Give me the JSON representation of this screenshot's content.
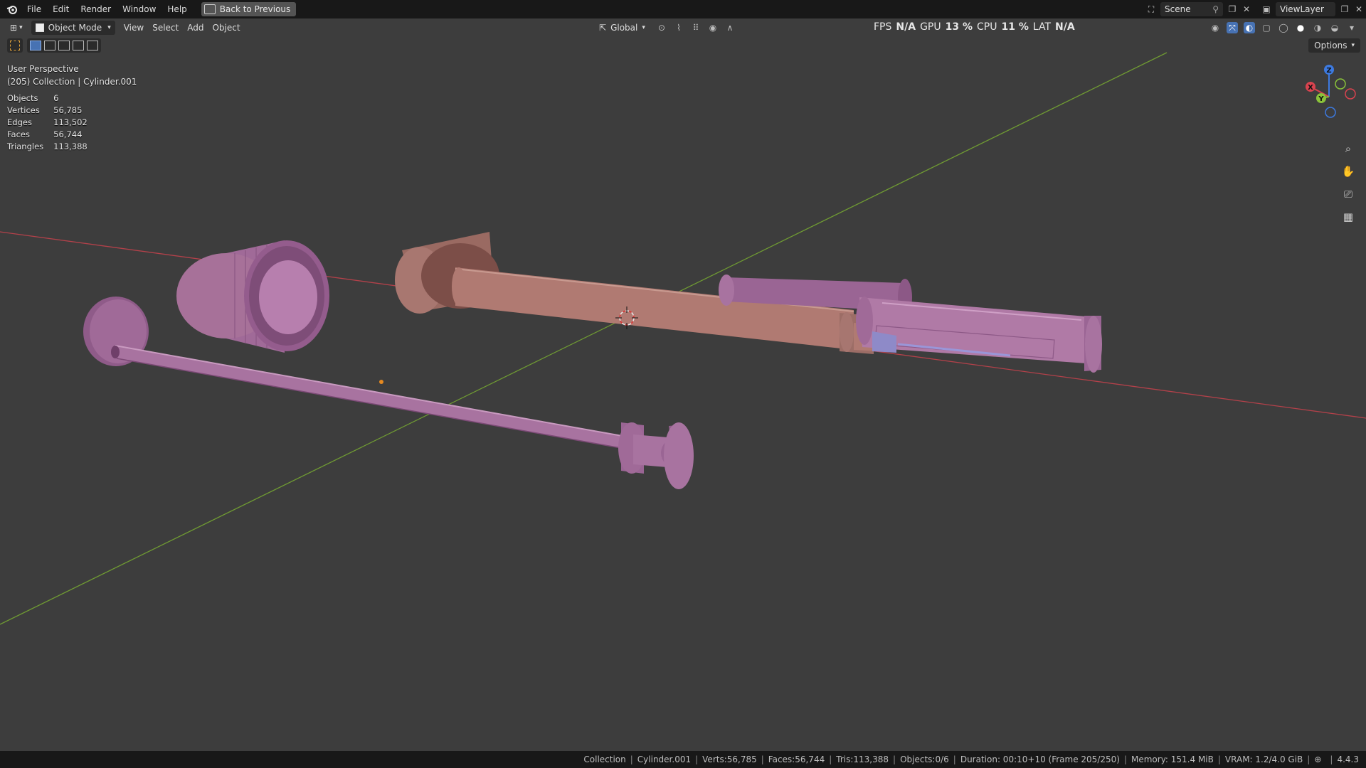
{
  "menu": {
    "items": [
      "File",
      "Edit",
      "Render",
      "Window",
      "Help"
    ],
    "back_button": "Back to Previous"
  },
  "scene": {
    "name": "Scene",
    "view_layer": "ViewLayer"
  },
  "viewport_header": {
    "mode": "Object Mode",
    "menus": [
      "View",
      "Select",
      "Add",
      "Object"
    ],
    "transform_orientation": "Global",
    "options": "Options"
  },
  "perf": {
    "fps_label": "FPS",
    "fps_value": "N/A",
    "gpu_label": "GPU",
    "gpu_value": "13 %",
    "cpu_label": "CPU",
    "cpu_value": "11 %",
    "lat_label": "LAT",
    "lat_value": "N/A"
  },
  "overlay": {
    "view_name": "User Perspective",
    "context": "(205) Collection | Cylinder.001"
  },
  "stats": [
    {
      "label": "Objects",
      "value": "6"
    },
    {
      "label": "Vertices",
      "value": "56,785"
    },
    {
      "label": "Edges",
      "value": "113,502"
    },
    {
      "label": "Faces",
      "value": "56,744"
    },
    {
      "label": "Triangles",
      "value": "113,388"
    }
  ],
  "gizmo": {
    "x": "X",
    "y": "Y",
    "z": "Z"
  },
  "statusbar": {
    "collection": "Collection",
    "object": "Cylinder.001",
    "verts": "Verts:56,785",
    "faces": "Faces:56,744",
    "tris": "Tris:113,388",
    "objects": "Objects:0/6",
    "duration": "Duration: 00:10+10 (Frame 205/250)",
    "memory": "Memory: 151.4 MiB",
    "vram": "VRAM: 1.2/4.0 GiB",
    "version": "4.4.3"
  },
  "colors": {
    "viewport_bg": "#3d3d3d",
    "x_axis": "#b3414a",
    "y_axis": "#6f9a33",
    "mesh_pink": "#b07aa6",
    "mesh_salmon": "#b07a72",
    "accent": "#4772b3"
  }
}
